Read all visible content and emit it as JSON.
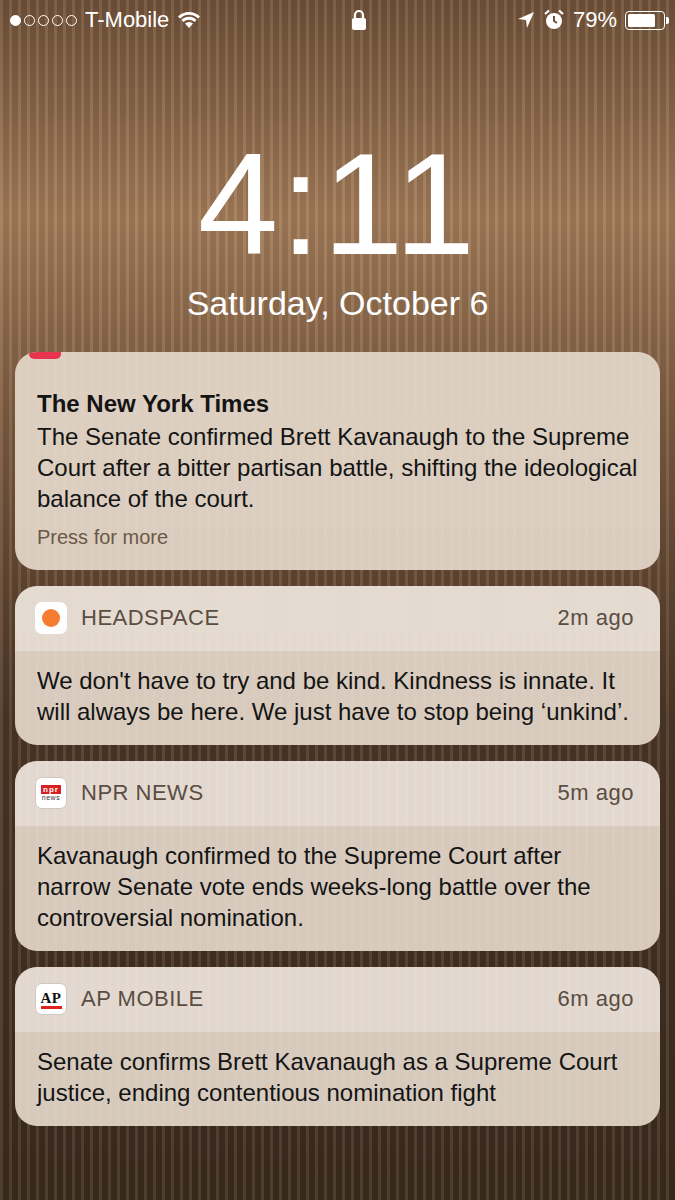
{
  "status_bar": {
    "signal": [
      {
        "filled": true
      },
      {
        "filled": false
      },
      {
        "filled": false
      },
      {
        "filled": false
      },
      {
        "filled": false
      }
    ],
    "carrier": "T-Mobile",
    "wifi": true,
    "locked": true,
    "location": true,
    "alarm": true,
    "battery": {
      "reading": "79%",
      "level": 0.79
    }
  },
  "lock_screen": {
    "time": "4:11",
    "date": "Saturday, October 6"
  },
  "notifications": [
    {
      "kind": "clipped",
      "app": "",
      "time": "",
      "icon_text": "",
      "icon_subtext": "",
      "icon_color": "#e8344e",
      "title": "The New York Times",
      "body": "The Senate confirmed Brett Kavanaugh to the Supreme Court after a bitter partisan battle, shifting the ideological balance of the court.",
      "action": "Press for more"
    },
    {
      "kind": "standard",
      "app": "HEADSPACE",
      "time": "2m ago",
      "icon_text": "",
      "icon_subtext": "",
      "icon_color": "#f47d31",
      "title": "",
      "body": "We don't have to try and be kind. Kindness is innate. It will always be here. We just have to stop being ‘unkind’.",
      "action": ""
    },
    {
      "kind": "standard",
      "app": "NPR NEWS",
      "time": "5m ago",
      "icon_text": "npr",
      "icon_subtext": "news",
      "icon_color": "#d62021",
      "title": "",
      "body": "Kavanaugh confirmed to the Supreme Court after narrow Senate vote ends weeks-long battle over the controversial nomination.",
      "action": ""
    },
    {
      "kind": "standard",
      "app": "AP MOBILE",
      "time": "6m ago",
      "icon_text": "AP",
      "icon_subtext": "",
      "icon_color": "#e2231a",
      "title": "",
      "body": "Senate confirms Brett Kavanaugh as a Supreme Court justice, ending contentious nomination fight",
      "action": ""
    }
  ]
}
